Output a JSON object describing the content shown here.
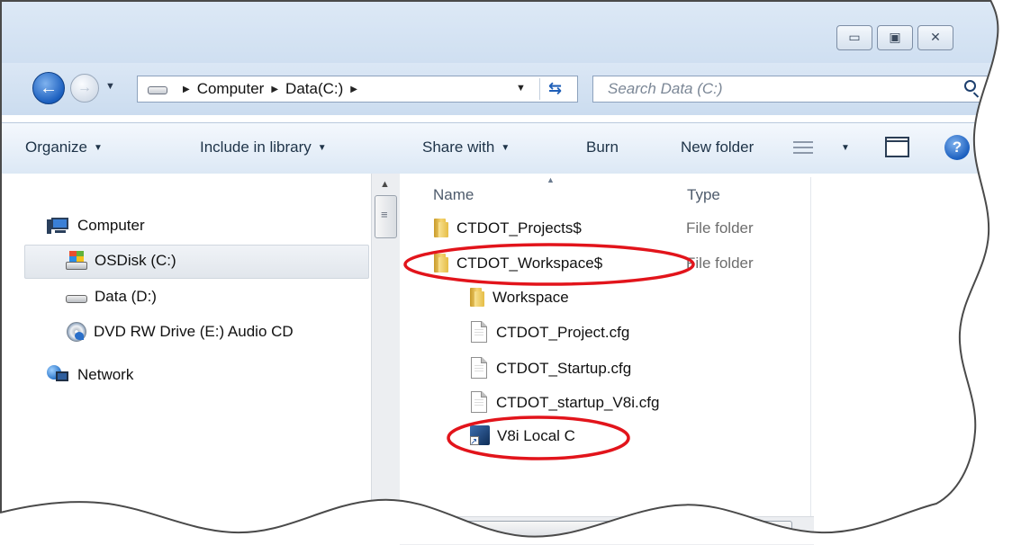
{
  "window": {
    "buttons": {
      "minimize": "▭",
      "maximize": "▣",
      "close": "✕"
    }
  },
  "address_bar": {
    "breadcrumb": [
      "Computer",
      "Data(C:)"
    ],
    "search_placeholder": "Search Data (C:)"
  },
  "command_bar": {
    "items": [
      {
        "label": "Organize",
        "has_dropdown": true
      },
      {
        "label": "Include in library",
        "has_dropdown": true
      },
      {
        "label": "Share with",
        "has_dropdown": true
      },
      {
        "label": "Burn",
        "has_dropdown": false
      },
      {
        "label": "New folder",
        "has_dropdown": false
      }
    ],
    "help": "?"
  },
  "nav_pane": {
    "items": [
      {
        "label": "Computer",
        "icon": "computer-icon"
      },
      {
        "label": "OSDisk (C:)",
        "icon": "os-drive-icon",
        "selected": true
      },
      {
        "label": "Data (D:)",
        "icon": "drive-icon"
      },
      {
        "label": "DVD RW Drive (E:) Audio CD",
        "icon": "dvd-drive-icon"
      },
      {
        "label": "Network",
        "icon": "network-icon"
      }
    ]
  },
  "file_list": {
    "columns": {
      "name": "Name",
      "type": "Type"
    },
    "rows": [
      {
        "name": "CTDOT_Projects$",
        "type": "File folder",
        "icon": "folder-icon",
        "highlighted": false
      },
      {
        "name": "CTDOT_Workspace$",
        "type": "File folder",
        "icon": "folder-icon",
        "highlighted": true
      },
      {
        "name": "Workspace",
        "type": "",
        "icon": "folder-icon",
        "highlighted": false
      },
      {
        "name": "CTDOT_Project.cfg",
        "type": "",
        "icon": "file-icon",
        "highlighted": false
      },
      {
        "name": "CTDOT_Startup.cfg",
        "type": "",
        "icon": "file-icon",
        "highlighted": false
      },
      {
        "name": "CTDOT_startup_V8i.cfg",
        "type": "",
        "icon": "file-icon",
        "highlighted": false
      },
      {
        "name": "V8i Local C",
        "type": "",
        "icon": "shortcut-icon",
        "highlighted": true
      }
    ]
  },
  "colors": {
    "annotation": "#e2141b",
    "accent": "#1b5fbf"
  }
}
